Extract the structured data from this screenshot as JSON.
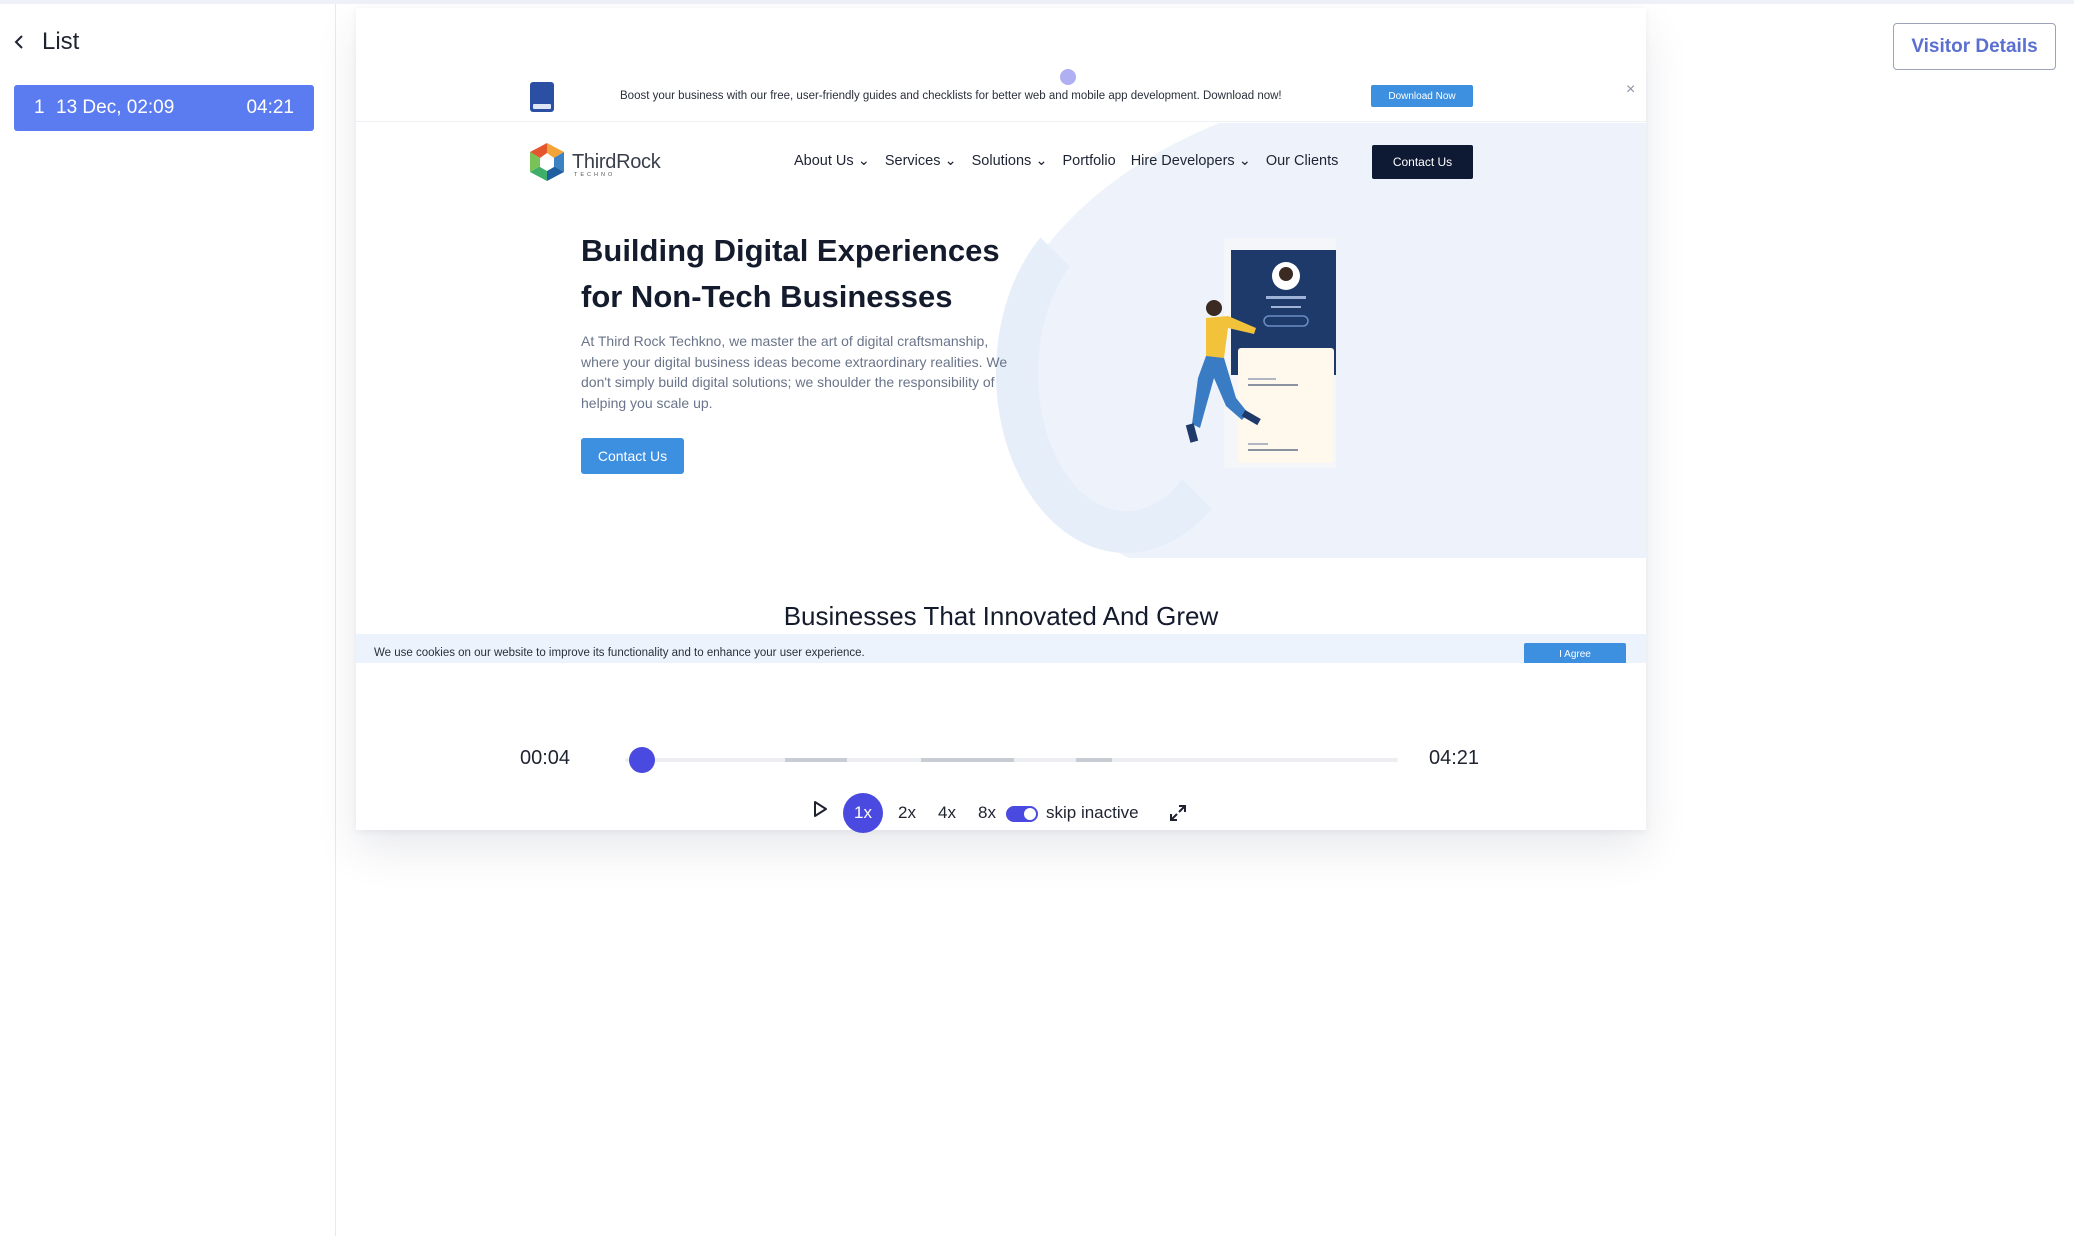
{
  "sidebar": {
    "back_label": "List",
    "sessions": [
      {
        "index": "1",
        "date": "13 Dec, 02:09",
        "duration": "04:21"
      }
    ]
  },
  "header": {
    "visitor_button": "Visitor Details"
  },
  "site": {
    "announcement": {
      "text": "Boost your business with our free, user-friendly guides and checklists for better web and mobile app development. Download now!",
      "button": "Download Now",
      "close": "×"
    },
    "logo": {
      "name": "ThirdRock",
      "sub": "TECHNO"
    },
    "nav": [
      "About Us",
      "Services",
      "Solutions",
      "Portfolio",
      "Hire Developers",
      "Our Clients"
    ],
    "nav_dropdown": [
      true,
      true,
      true,
      false,
      true,
      false
    ],
    "nav_cta": "Contact Us",
    "hero": {
      "title_line1": "Building Digital Experiences",
      "title_line2": "for Non-Tech Businesses",
      "description": "At Third Rock Techkno, we master the art of digital craftsmanship, where your digital business ideas become extraordinary realities. We don't simply build digital solutions; we shoulder the responsibility of helping you scale up.",
      "cta": "Contact Us"
    },
    "section_title": "Businesses That Innovated And Grew",
    "cookie": {
      "text": "We use cookies on our website to improve its functionality and to enhance your user experience.",
      "button": "I Agree"
    }
  },
  "player": {
    "current_time": "00:04",
    "total_time": "04:21",
    "progress": 0.016,
    "speeds": [
      "1x",
      "2x",
      "4x",
      "8x"
    ],
    "active_speed": "1x",
    "skip_inactive_label": "skip inactive",
    "skip_inactive": true
  },
  "colors": {
    "accent": "#4a4ae0",
    "session_bg": "#5b7cf0",
    "site_blue": "#3d8fe0",
    "site_dark": "#0e1a33"
  }
}
